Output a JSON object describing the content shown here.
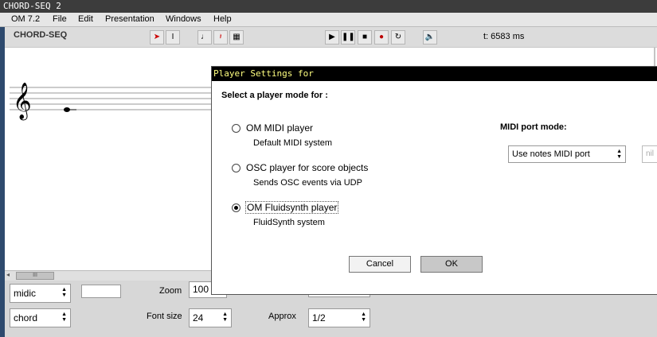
{
  "window": {
    "title": "CHORD-SEQ 2"
  },
  "menubar": [
    "OM 7.2",
    "File",
    "Edit",
    "Presentation",
    "Windows",
    "Help"
  ],
  "editor": {
    "name": "CHORD-SEQ",
    "time_readout": "t: 6583 ms"
  },
  "toolbar": {
    "tools": [
      "arrow-icon",
      "text-cursor-icon",
      "note-icon",
      "rest-icon",
      "score-icon"
    ],
    "playback": [
      "play-icon",
      "pause-icon",
      "stop-icon",
      "record-icon",
      "loop-icon",
      "speaker-icon"
    ]
  },
  "bottom": {
    "midic_select": "midic",
    "chord_select": "chord",
    "zoom_label": "Zoom",
    "zoom_value": "100",
    "fontsize_label": "Font size",
    "fontsize_value": "24",
    "approx_label": "Approx",
    "approx_value": "1/2"
  },
  "scroll": {
    "thumb_label": "III"
  },
  "dialog": {
    "title": "Player Settings for",
    "prompt": "Select a player mode for  :",
    "options": [
      {
        "label": "OM MIDI player",
        "desc": "Default MIDI system",
        "selected": false
      },
      {
        "label": "OSC player for score objects",
        "desc": "Sends OSC events via UDP",
        "selected": false
      },
      {
        "label": "OM Fluidsynth player",
        "desc": "FluidSynth system",
        "selected": true
      }
    ],
    "midi_port_label": "MIDI port mode:",
    "midi_port_value": "Use notes MIDI port",
    "nil_placeholder": "nil",
    "cancel_label": "Cancel",
    "ok_label": "OK"
  }
}
